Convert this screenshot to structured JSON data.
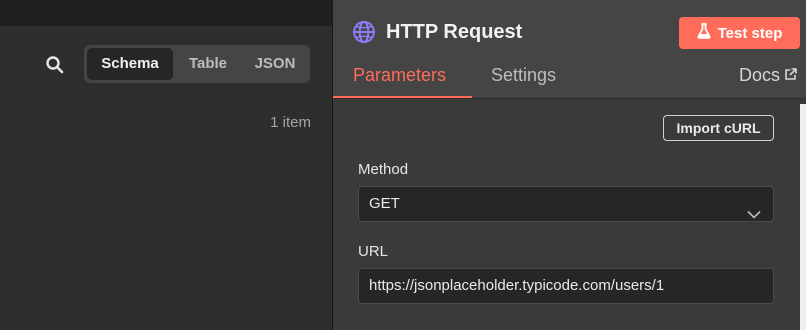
{
  "left": {
    "view_tabs": [
      "Schema",
      "Table",
      "JSON"
    ],
    "active_view": "Schema",
    "item_count": "1 item"
  },
  "ndv": {
    "node_title": "HTTP Request",
    "test_button": "Test step",
    "tabs": [
      "Parameters",
      "Settings"
    ],
    "active_tab": "Parameters",
    "docs_label": "Docs",
    "import_button": "Import cURL",
    "method": {
      "label": "Method",
      "value": "GET"
    },
    "url": {
      "label": "URL",
      "value": "https://jsonplaceholder.typicode.com/users/1"
    }
  },
  "colors": {
    "accent": "#ff6d5a",
    "node_icon": "#8b7cf6"
  }
}
